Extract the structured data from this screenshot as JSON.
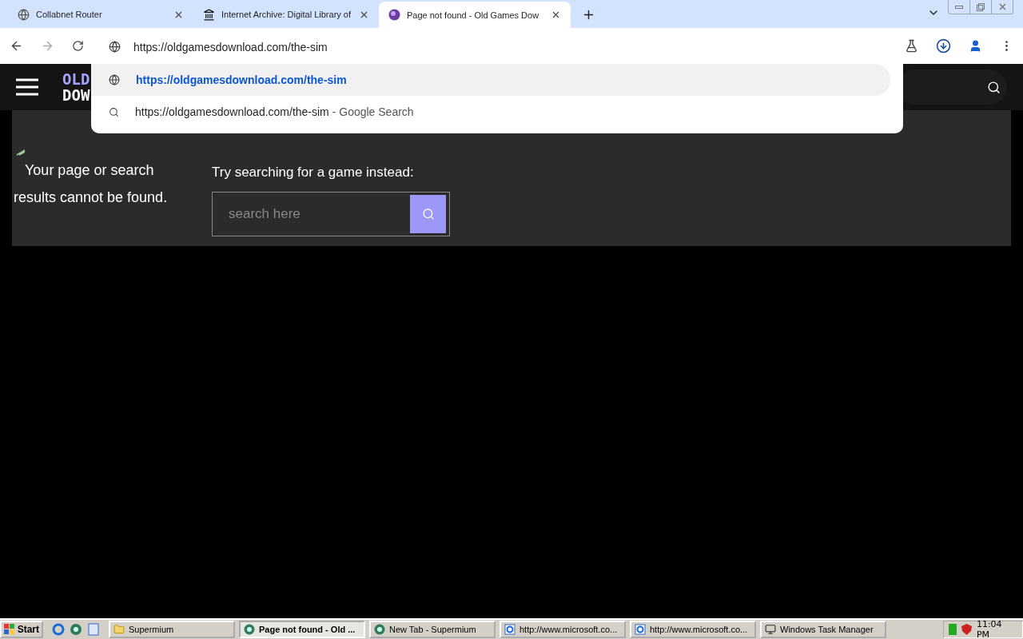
{
  "browser": {
    "tabs": [
      {
        "title": "Collabnet Router",
        "selected": false
      },
      {
        "title": "Internet Archive: Digital Library of",
        "selected": false
      },
      {
        "title": "Page not found - Old Games Dow",
        "selected": true
      }
    ],
    "omnibox": {
      "value": "https://oldgamesdownload.com/the-sim"
    },
    "suggestions": [
      {
        "kind": "url",
        "text": "https://oldgamesdownload.com/the-sim",
        "selected": true
      },
      {
        "kind": "search",
        "text": "https://oldgamesdownload.com/the-sim",
        "suffix": "- Google Search",
        "selected": false
      }
    ]
  },
  "page": {
    "logo": [
      "OLD",
      "DOW"
    ],
    "message": "Your page or search results cannot be found.",
    "prompt": "Try searching for a game instead:",
    "search": {
      "placeholder": "search here"
    }
  },
  "taskbar": {
    "start": "Start",
    "buttons": [
      {
        "label": "Supermium",
        "selected": false
      },
      {
        "label": "Page not found - Old ...",
        "selected": true
      },
      {
        "label": "New Tab - Supermium",
        "selected": false
      },
      {
        "label": "http://www.microsoft.co...",
        "selected": false
      },
      {
        "label": "http://www.microsoft.co...",
        "selected": false
      },
      {
        "label": "Windows Task Manager",
        "selected": false
      }
    ],
    "clock": "11:04 PM"
  }
}
